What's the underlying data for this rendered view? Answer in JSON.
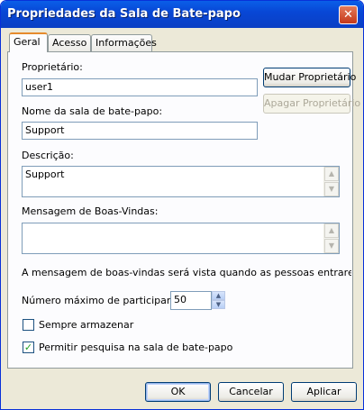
{
  "window": {
    "title": "Propriedades da Sala de Bate-papo",
    "close_glyph": "✕"
  },
  "tabs": [
    {
      "label": "Geral",
      "active": true
    },
    {
      "label": "Acesso",
      "active": false
    },
    {
      "label": "Informações",
      "active": false
    }
  ],
  "owner": {
    "label": "Proprietário:",
    "value": "user1",
    "change_button": "Mudar Proprietário",
    "delete_button": "Apagar Proprietário",
    "delete_enabled": false
  },
  "room_name": {
    "label": "Nome da sala de bate-papo:",
    "value": "Support"
  },
  "description": {
    "label": "Descrição:",
    "value": "Support"
  },
  "welcome": {
    "label": "Mensagem de Boas-Vindas:",
    "value": "",
    "note": "A mensagem de boas-vindas será vista quando as pessoas entrarem na sala de"
  },
  "max_participants": {
    "label": "Número máximo de participantes:",
    "value": "50"
  },
  "always_store": {
    "label": "Sempre armazenar",
    "checked": false
  },
  "allow_search": {
    "label": "Permitir pesquisa na sala de bate-papo",
    "checked": true,
    "check_glyph": "✓"
  },
  "icons": {
    "scroll_up": "▲",
    "scroll_down": "▼"
  },
  "footer": {
    "ok": "OK",
    "cancel": "Cancelar",
    "apply": "Aplicar"
  }
}
